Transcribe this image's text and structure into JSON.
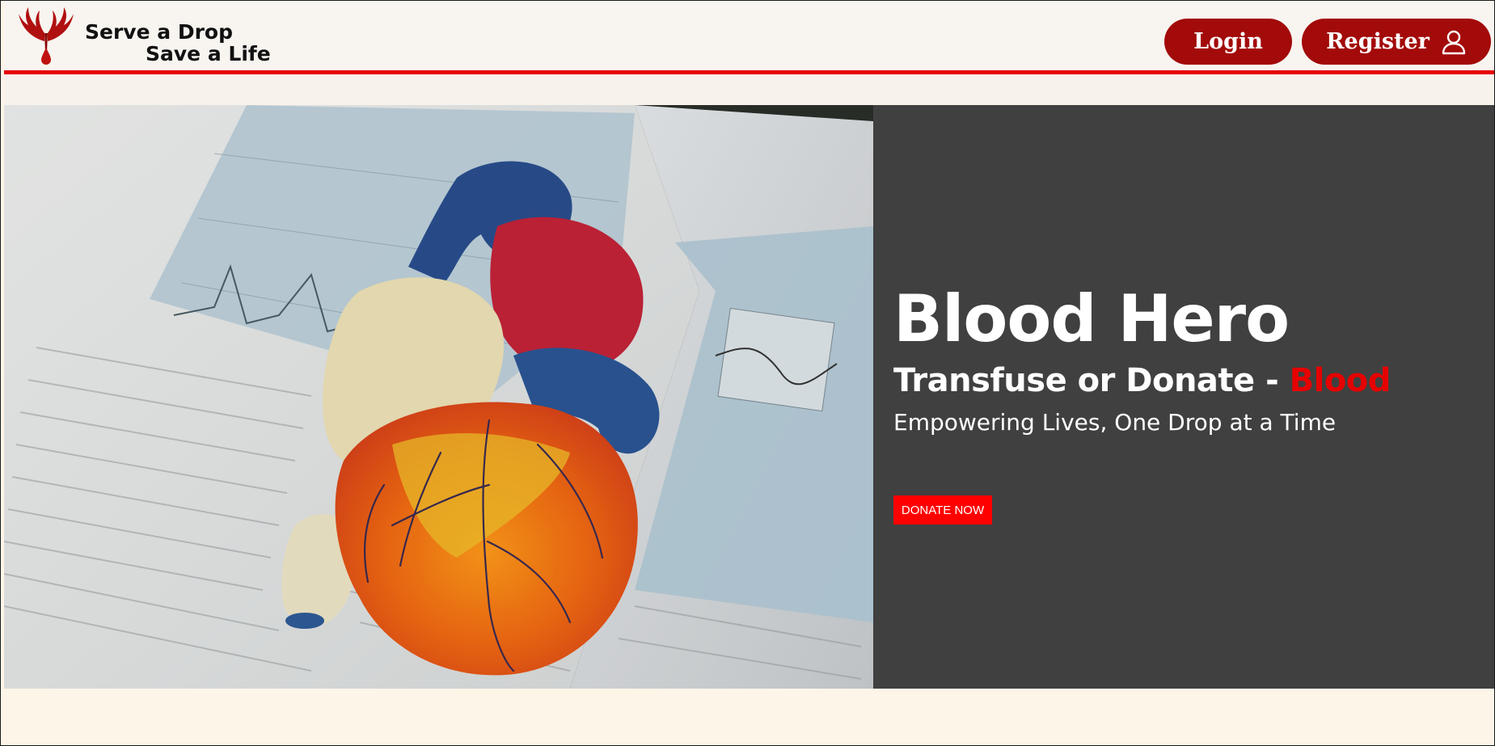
{
  "brand": {
    "line1": "Serve a Drop",
    "line2": "Save a Life",
    "logo_icon": "hands-blood-drop-icon",
    "accent_color": "#a30a0a"
  },
  "nav": {
    "login_label": "Login",
    "register_label": "Register",
    "register_icon": "user-icon",
    "rule_color": "#e60000"
  },
  "hero": {
    "image_desc_icon": "heart-model-on-book-image",
    "title": "Blood Hero",
    "subtitle_prefix": "Transfuse or Donate - ",
    "subtitle_accent": "Blood",
    "tagline": "Empowering Lives, One Drop at a Time",
    "cta_label": "DONATE NOW",
    "panel_color": "#404040",
    "cta_color": "#ff0000"
  }
}
